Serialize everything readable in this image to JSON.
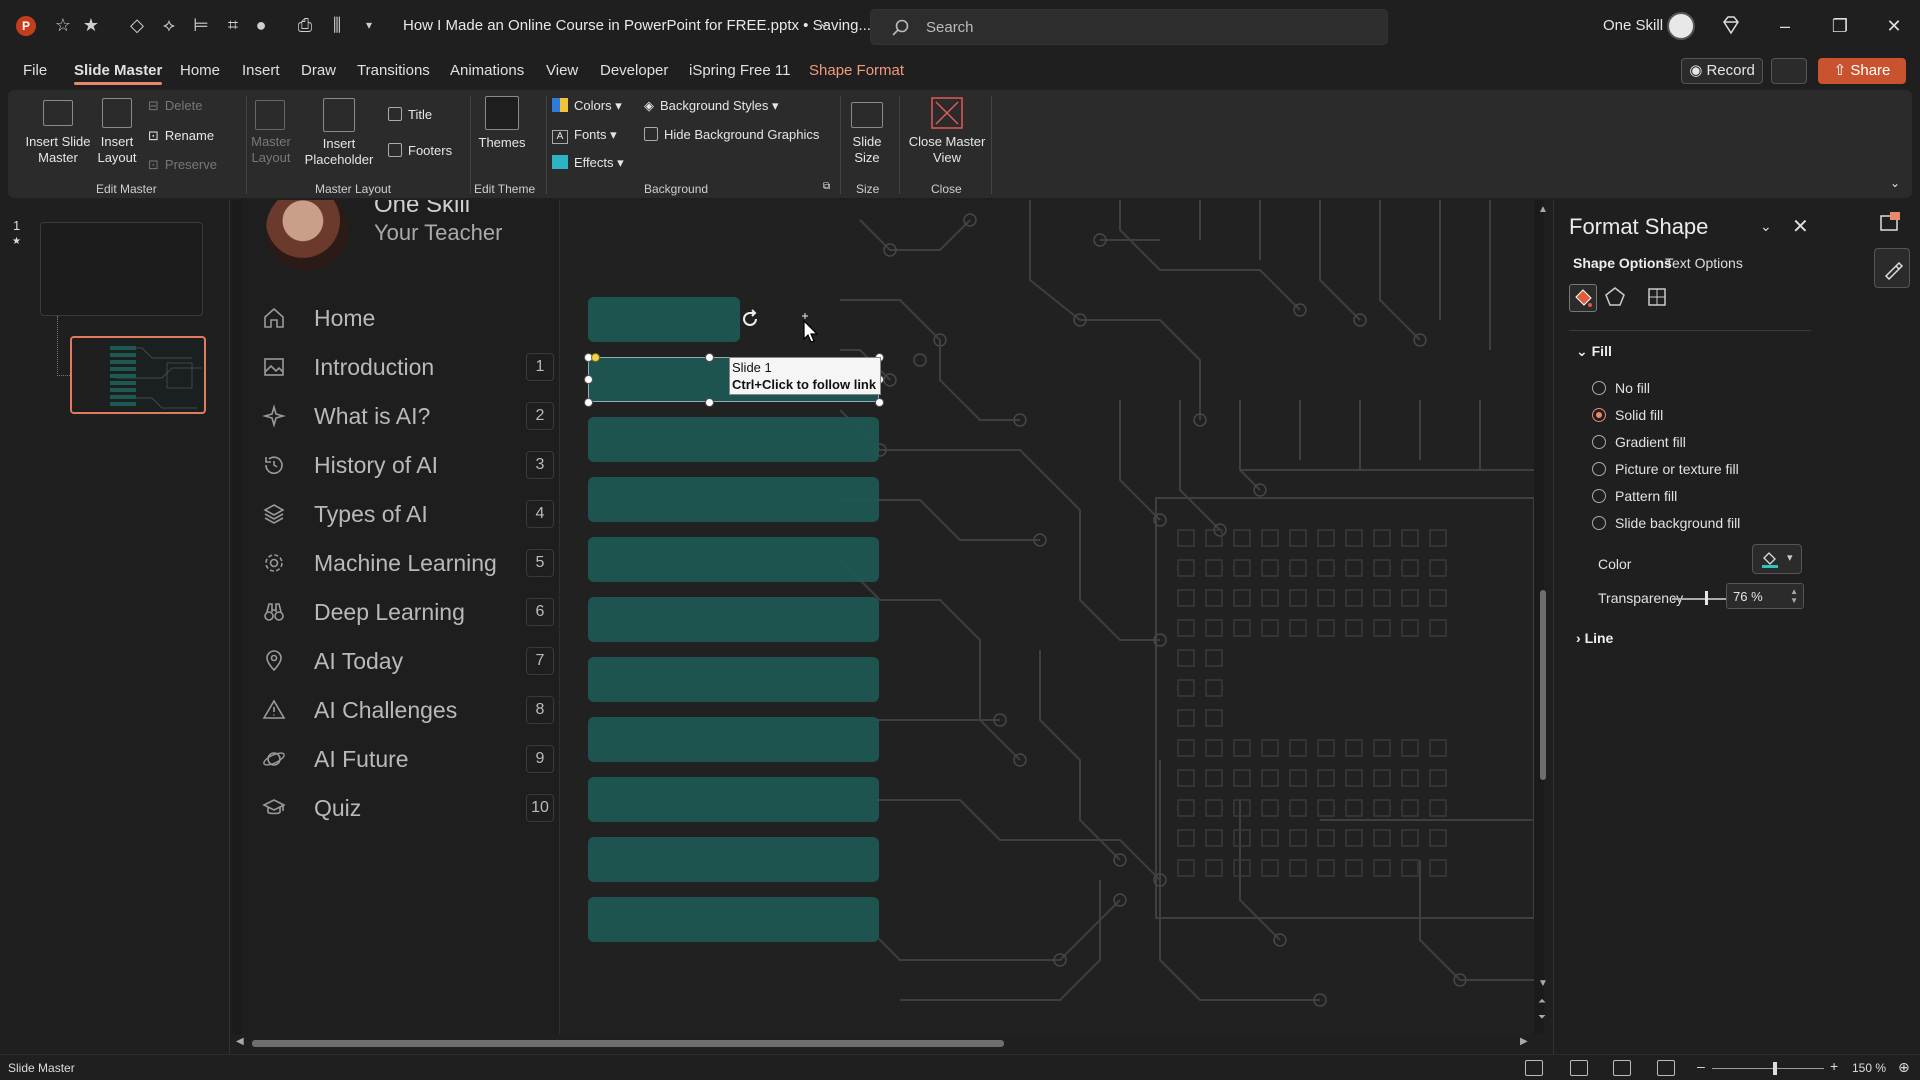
{
  "titlebar": {
    "doc_title": "How I Made an Online Course in PowerPoint for FREE.pptx • Saving...",
    "search_placeholder": "Search",
    "user_name": "One Skill"
  },
  "tabs": [
    "File",
    "Slide Master",
    "Home",
    "Insert",
    "Draw",
    "Transitions",
    "Animations",
    "View",
    "Developer",
    "iSpring Free 11",
    "Shape Format"
  ],
  "active_tab": "Slide Master",
  "record_label": "Record",
  "share_label": "Share",
  "ribbon": {
    "insert_slide_master": "Insert Slide Master",
    "insert_layout": "Insert Layout",
    "delete": "Delete",
    "rename": "Rename",
    "preserve": "Preserve",
    "edit_master_group": "Edit Master",
    "master_layout": "Master Layout",
    "insert_placeholder": "Insert Placeholder",
    "title_chk": "Title",
    "footers_chk": "Footers",
    "master_layout_group": "Master Layout",
    "themes": "Themes",
    "edit_theme_group": "Edit Theme",
    "colors": "Colors",
    "fonts": "Fonts",
    "effects": "Effects",
    "background_styles": "Background Styles",
    "hide_background_graphics": "Hide Background Graphics",
    "background_group": "Background",
    "slide_size": "Slide Size",
    "size_group": "Size",
    "close_master_view": "Close Master View",
    "close_group": "Close"
  },
  "thumbnails": {
    "slide_number": "1"
  },
  "slide": {
    "teacher_name": "One Skill",
    "teacher_role": "Your Teacher",
    "menu": [
      {
        "label": "Home",
        "num": "",
        "icon": "home-icon"
      },
      {
        "label": "Introduction",
        "num": "1",
        "icon": "image-icon"
      },
      {
        "label": "What is AI?",
        "num": "2",
        "icon": "sparkle-icon"
      },
      {
        "label": "History of AI",
        "num": "3",
        "icon": "history-icon"
      },
      {
        "label": "Types of AI",
        "num": "4",
        "icon": "layers-icon"
      },
      {
        "label": "Machine Learning",
        "num": "5",
        "icon": "gear-icon"
      },
      {
        "label": "Deep Learning",
        "num": "6",
        "icon": "binoculars-icon"
      },
      {
        "label": "AI Today",
        "num": "7",
        "icon": "location-pin-icon"
      },
      {
        "label": "AI Challenges",
        "num": "8",
        "icon": "warning-icon"
      },
      {
        "label": "AI Future",
        "num": "9",
        "icon": "planet-icon"
      },
      {
        "label": "Quiz",
        "num": "10",
        "icon": "graduation-cap-icon"
      }
    ],
    "tooltip_line1": "Slide 1",
    "tooltip_line2": "Ctrl+Click to follow link",
    "bar_color": "#1f5753"
  },
  "format_pane": {
    "title": "Format Shape",
    "tab_shape": "Shape Options",
    "tab_text": "Text Options",
    "fill_header": "Fill",
    "fill_options": [
      "No fill",
      "Solid fill",
      "Gradient fill",
      "Picture or texture fill",
      "Pattern fill",
      "Slide background fill"
    ],
    "selected_fill": "Solid fill",
    "color_label": "Color",
    "color_value": "#2ec4c4",
    "transparency_label": "Transparency",
    "transparency_value": "76 %",
    "line_header": "Line"
  },
  "status": {
    "left": "Slide Master",
    "zoom": "150 %"
  },
  "accent_color": "#e7886a"
}
